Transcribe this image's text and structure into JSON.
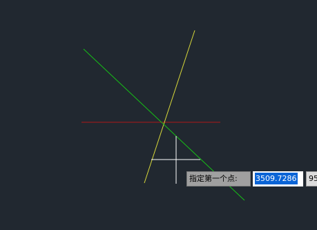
{
  "canvas": {
    "background": "#212830"
  },
  "colors": {
    "red_line": "#b01818",
    "yellow_line": "#d8d83a",
    "green_line": "#16c216",
    "crosshair": "#ffffff"
  },
  "prompt": {
    "label": "指定第一个点:"
  },
  "coordinates": {
    "x_value": "3509.7286",
    "y_value": "95"
  }
}
